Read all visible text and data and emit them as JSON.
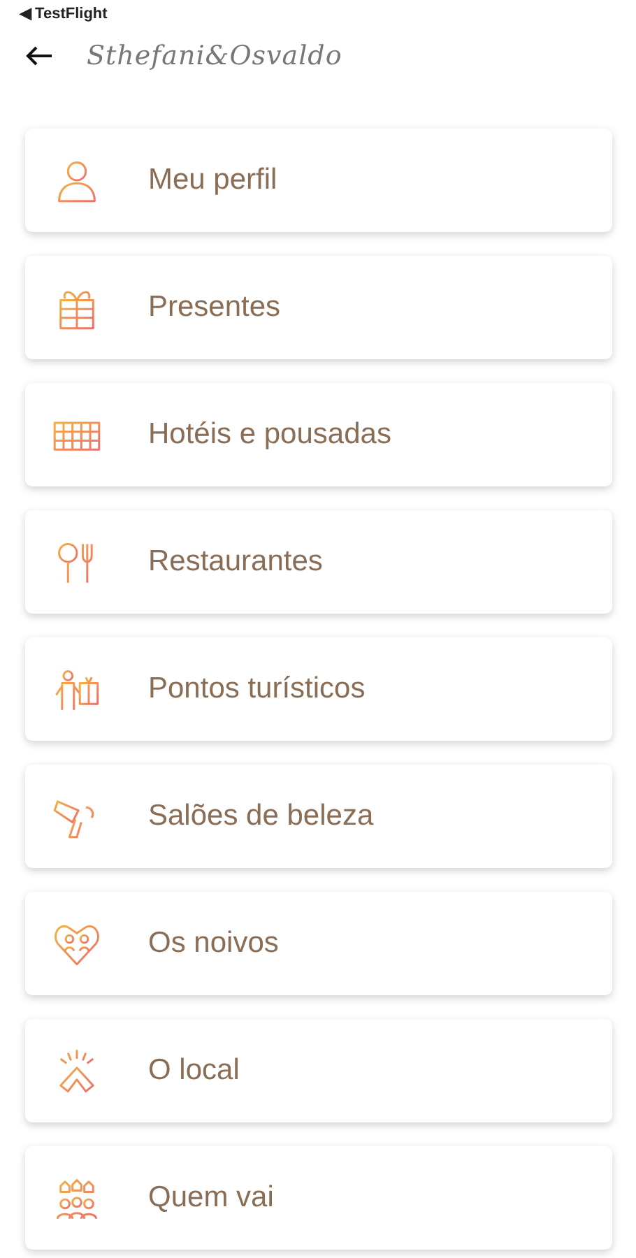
{
  "status_bar": {
    "back_label": "◀ TestFlight"
  },
  "header": {
    "logo": "Sthefani&Osvaldo"
  },
  "menu": [
    {
      "label": "Meu perfil",
      "kind": "person"
    },
    {
      "label": "Presentes",
      "kind": "gift"
    },
    {
      "label": "Hotéis e pousadas",
      "kind": "hotel"
    },
    {
      "label": "Restaurantes",
      "kind": "cutlery"
    },
    {
      "label": "Pontos turísticos",
      "kind": "tourist"
    },
    {
      "label": "Salões de beleza",
      "kind": "salon"
    },
    {
      "label": "Os noivos",
      "kind": "couple"
    },
    {
      "label": "O local",
      "kind": "place"
    },
    {
      "label": "Quem vai",
      "kind": "guests"
    }
  ]
}
